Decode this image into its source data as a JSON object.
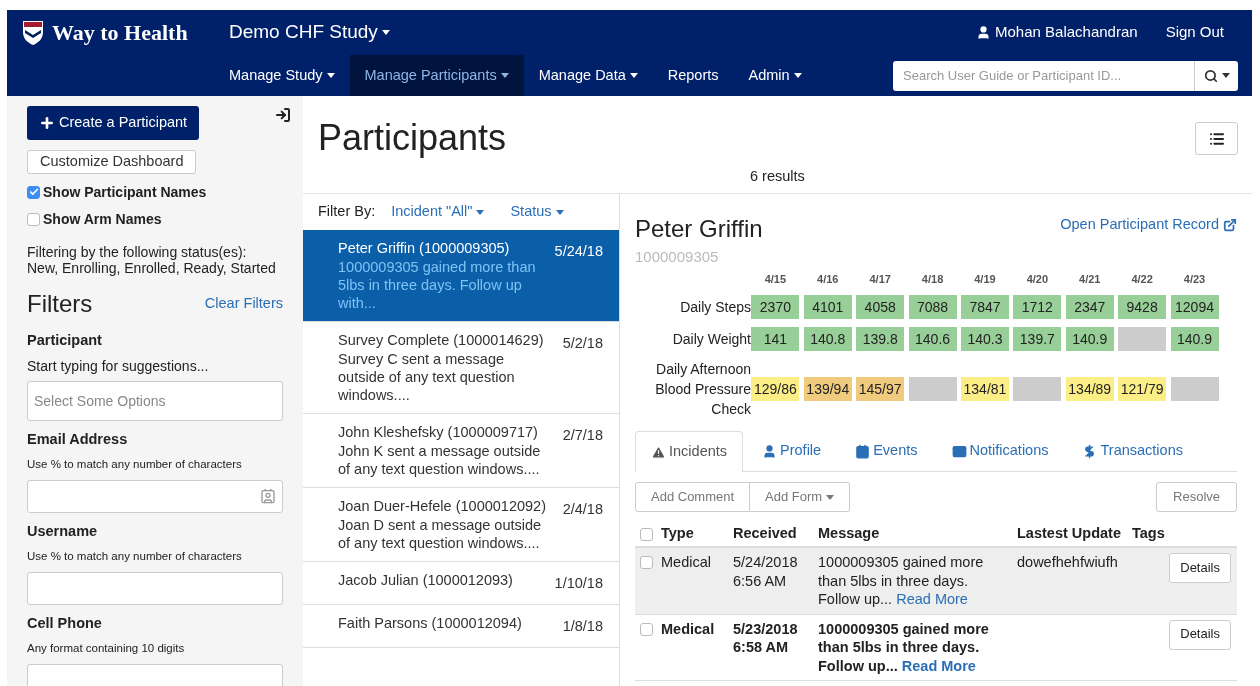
{
  "header": {
    "logo": "Way to Health",
    "study": "Demo CHF Study",
    "user": "Mohan Balachandran",
    "sign_out": "Sign Out",
    "nav": [
      {
        "label": "Manage Study",
        "selected": false,
        "dropdown": true
      },
      {
        "label": "Manage Participants",
        "selected": true,
        "dropdown": true
      },
      {
        "label": "Manage Data",
        "selected": false,
        "dropdown": true
      },
      {
        "label": "Reports",
        "selected": false,
        "dropdown": false
      },
      {
        "label": "Admin",
        "selected": false,
        "dropdown": true
      }
    ],
    "search": {
      "placeholder": "Search User Guide or Participant ID..."
    }
  },
  "sidebar": {
    "create_button": "Create a Participant",
    "customize_button": "Customize Dashboard",
    "checkboxes": [
      {
        "label": "Show Participant Names",
        "checked": true
      },
      {
        "label": "Show Arm Names",
        "checked": false
      }
    ],
    "filter_note": [
      "Filtering by the following status(es):",
      "New, Enrolling, Enrolled, Ready, Started"
    ],
    "filters_title": "Filters",
    "clear_filters": "Clear Filters",
    "fields": [
      {
        "label": "Participant",
        "hint": "Start typing for suggestions...",
        "kind": "select",
        "placeholder": "Select Some Options"
      },
      {
        "label": "Email Address",
        "hint": "Use % to match any number of characters",
        "kind": "contact"
      },
      {
        "label": "Username",
        "hint": "Use % to match any number of characters",
        "kind": "text"
      },
      {
        "label": "Cell Phone",
        "hint": "Any format containing 10 digits",
        "kind": "text"
      }
    ]
  },
  "main": {
    "title": "Participants",
    "results": "6 results",
    "filter_by": "Filter By:",
    "filters": [
      "Incident \"All\"",
      "Status"
    ],
    "participants": [
      {
        "name": "Peter Griffin (1000009305)",
        "date": "5/24/18",
        "message": "1000009305 gained more than 5lbs in three days. Follow up with...",
        "selected": true
      },
      {
        "name": "Survey Complete (1000014629)",
        "date": "5/2/18",
        "message": "Survey C sent a message outside of any text question windows....",
        "selected": false
      },
      {
        "name": "John Kleshefsky (1000009717)",
        "date": "2/7/18",
        "message": "John K sent a message outside of any text question windows....",
        "selected": false
      },
      {
        "name": "Joan Duer-Hefele (1000012092)",
        "date": "2/4/18",
        "message": "Joan D sent a message outside of any text question windows....",
        "selected": false
      },
      {
        "name": "Jacob Julian (1000012093)",
        "date": "1/10/18",
        "selected": false
      },
      {
        "name": "Faith Parsons (1000012094)",
        "date": "1/8/18",
        "selected": false
      }
    ],
    "detail": {
      "name": "Peter Griffin",
      "id": "1000009305",
      "open_record": "Open Participant Record",
      "dates": [
        "4/15",
        "4/16",
        "4/17",
        "4/18",
        "4/19",
        "4/20",
        "4/21",
        "4/22",
        "4/23"
      ],
      "metrics": [
        {
          "label": "Daily Steps",
          "cells": [
            {
              "value": "2370",
              "color": "#98cf98"
            },
            {
              "value": "4101",
              "color": "#98cf98"
            },
            {
              "value": "4058",
              "color": "#98cf98"
            },
            {
              "value": "7088",
              "color": "#98cf98"
            },
            {
              "value": "7847",
              "color": "#98cf98"
            },
            {
              "value": "1712",
              "color": "#98cf98"
            },
            {
              "value": "2347",
              "color": "#98cf98"
            },
            {
              "value": "9428",
              "color": "#98cf98"
            },
            {
              "value": "12094",
              "color": "#98cf98"
            }
          ]
        },
        {
          "label": "Daily Weight",
          "cells": [
            {
              "value": "141",
              "color": "#98cf98"
            },
            {
              "value": "140.8",
              "color": "#98cf98"
            },
            {
              "value": "139.8",
              "color": "#98cf98"
            },
            {
              "value": "140.6",
              "color": "#98cf98"
            },
            {
              "value": "140.3",
              "color": "#98cf98"
            },
            {
              "value": "139.7",
              "color": "#98cf98"
            },
            {
              "value": "140.9",
              "color": "#98cf98"
            },
            {
              "color": "#cccccc"
            },
            {
              "value": "140.9",
              "color": "#98cf98"
            }
          ]
        },
        {
          "label": "Daily Afternoon Blood Pressure Check",
          "cells": [
            {
              "value": "129/86",
              "color": "#fcee86"
            },
            {
              "value": "139/94",
              "color": "#f0cb7e"
            },
            {
              "value": "145/97",
              "color": "#f0cb7e"
            },
            {
              "color": "#cccccc"
            },
            {
              "value": "134/81",
              "color": "#fcee86"
            },
            {
              "color": "#cccccc"
            },
            {
              "value": "134/89",
              "color": "#fcee86"
            },
            {
              "value": "121/79",
              "color": "#fcee86"
            },
            {
              "color": "#cccccc"
            }
          ]
        }
      ],
      "tabs": [
        {
          "label": "Incidents",
          "selected": true
        },
        {
          "label": "Profile",
          "selected": false
        },
        {
          "label": "Events",
          "selected": false
        },
        {
          "label": "Notifications",
          "selected": false
        },
        {
          "label": "Transactions",
          "selected": false
        }
      ],
      "actions": {
        "add_comment": "Add Comment",
        "add_form": "Add Form",
        "resolve": "Resolve"
      },
      "select_all_checked": false,
      "columns": [
        "Type",
        "Received",
        "Message",
        "Lastest Update",
        "Tags"
      ],
      "rows": [
        {
          "type": "Medical",
          "received": "5/24/2018 6:56 AM",
          "message": "1000009305 gained more than 5lbs in three days. Follow up...",
          "read_more": "Read More",
          "update": "dowefhehfwiufh",
          "details": "Details",
          "checked": false,
          "unread": false,
          "selected": true
        },
        {
          "type": "Medical",
          "received": "5/23/2018 6:58 AM",
          "message": "1000009305 gained more than 5lbs in three days. Follow up...",
          "read_more": "Read More",
          "details": "Details",
          "checked": false,
          "unread": true,
          "selected": false
        }
      ]
    }
  }
}
